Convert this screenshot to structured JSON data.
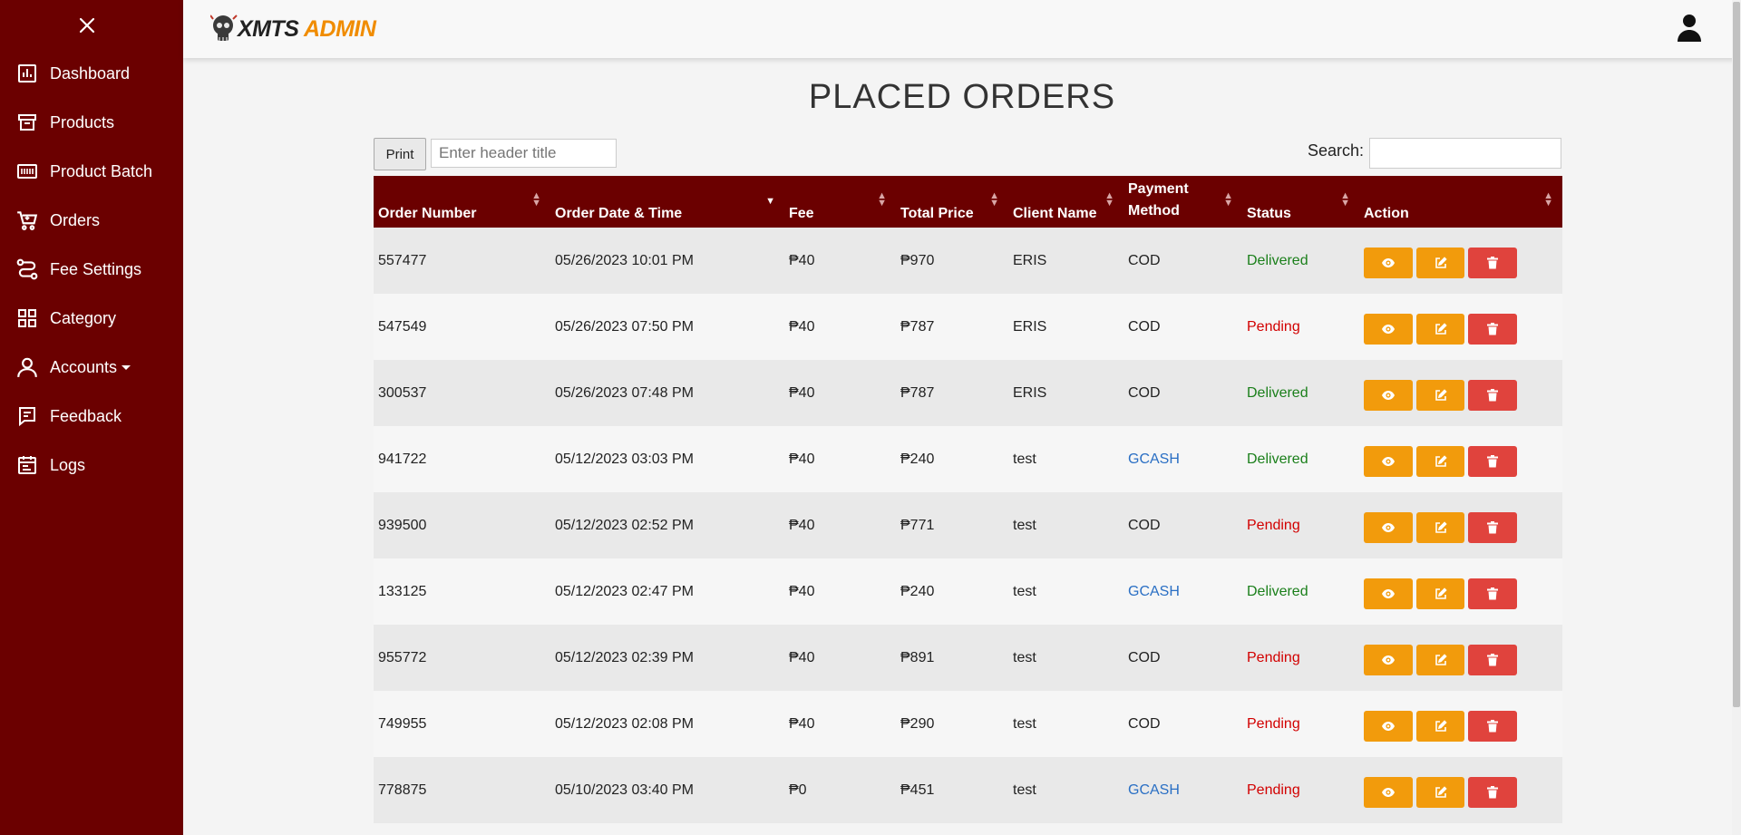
{
  "app": {
    "logo_part1": "XMTS",
    "logo_part2": "ADMIN"
  },
  "sidebar": {
    "items": [
      {
        "label": "Dashboard",
        "icon": "dashboard-icon"
      },
      {
        "label": "Products",
        "icon": "archive-icon"
      },
      {
        "label": "Product Batch",
        "icon": "barcode-icon"
      },
      {
        "label": "Orders",
        "icon": "cart-icon"
      },
      {
        "label": "Fee Settings",
        "icon": "route-icon"
      },
      {
        "label": "Category",
        "icon": "grid-icon"
      },
      {
        "label": "Accounts",
        "icon": "user-icon"
      },
      {
        "label": "Feedback",
        "icon": "message-icon"
      },
      {
        "label": "Logs",
        "icon": "calendar-icon"
      }
    ]
  },
  "page": {
    "title": "PLACED ORDERS"
  },
  "toolbar": {
    "print_label": "Print",
    "header_placeholder": "Enter header title",
    "search_label": "Search:"
  },
  "table": {
    "columns": [
      "Order Number",
      "Order Date & Time",
      "Fee",
      "Total Price",
      "Client Name",
      "Payment Method",
      "Status",
      "Action"
    ],
    "rows": [
      {
        "order": "557477",
        "date": "05/26/2023 10:01 PM",
        "fee": "₱40",
        "total": "₱970",
        "client": "ERIS",
        "payment": "COD",
        "status": "Delivered"
      },
      {
        "order": "547549",
        "date": "05/26/2023 07:50 PM",
        "fee": "₱40",
        "total": "₱787",
        "client": "ERIS",
        "payment": "COD",
        "status": "Pending"
      },
      {
        "order": "300537",
        "date": "05/26/2023 07:48 PM",
        "fee": "₱40",
        "total": "₱787",
        "client": "ERIS",
        "payment": "COD",
        "status": "Delivered"
      },
      {
        "order": "941722",
        "date": "05/12/2023 03:03 PM",
        "fee": "₱40",
        "total": "₱240",
        "client": "test",
        "payment": "GCASH",
        "status": "Delivered"
      },
      {
        "order": "939500",
        "date": "05/12/2023 02:52 PM",
        "fee": "₱40",
        "total": "₱771",
        "client": "test",
        "payment": "COD",
        "status": "Pending"
      },
      {
        "order": "133125",
        "date": "05/12/2023 02:47 PM",
        "fee": "₱40",
        "total": "₱240",
        "client": "test",
        "payment": "GCASH",
        "status": "Delivered"
      },
      {
        "order": "955772",
        "date": "05/12/2023 02:39 PM",
        "fee": "₱40",
        "total": "₱891",
        "client": "test",
        "payment": "COD",
        "status": "Pending"
      },
      {
        "order": "749955",
        "date": "05/12/2023 02:08 PM",
        "fee": "₱40",
        "total": "₱290",
        "client": "test",
        "payment": "COD",
        "status": "Pending"
      },
      {
        "order": "778875",
        "date": "05/10/2023 03:40 PM",
        "fee": "₱0",
        "total": "₱451",
        "client": "test",
        "payment": "GCASH",
        "status": "Pending"
      }
    ]
  },
  "colors": {
    "sidebar": "#6b0000",
    "header_row": "#6b0000",
    "delivered": "#1a7f1a",
    "pending": "#d20000",
    "gcash": "#2a6fc4",
    "action_orange": "#f29b0c",
    "action_red": "#e0433d"
  }
}
